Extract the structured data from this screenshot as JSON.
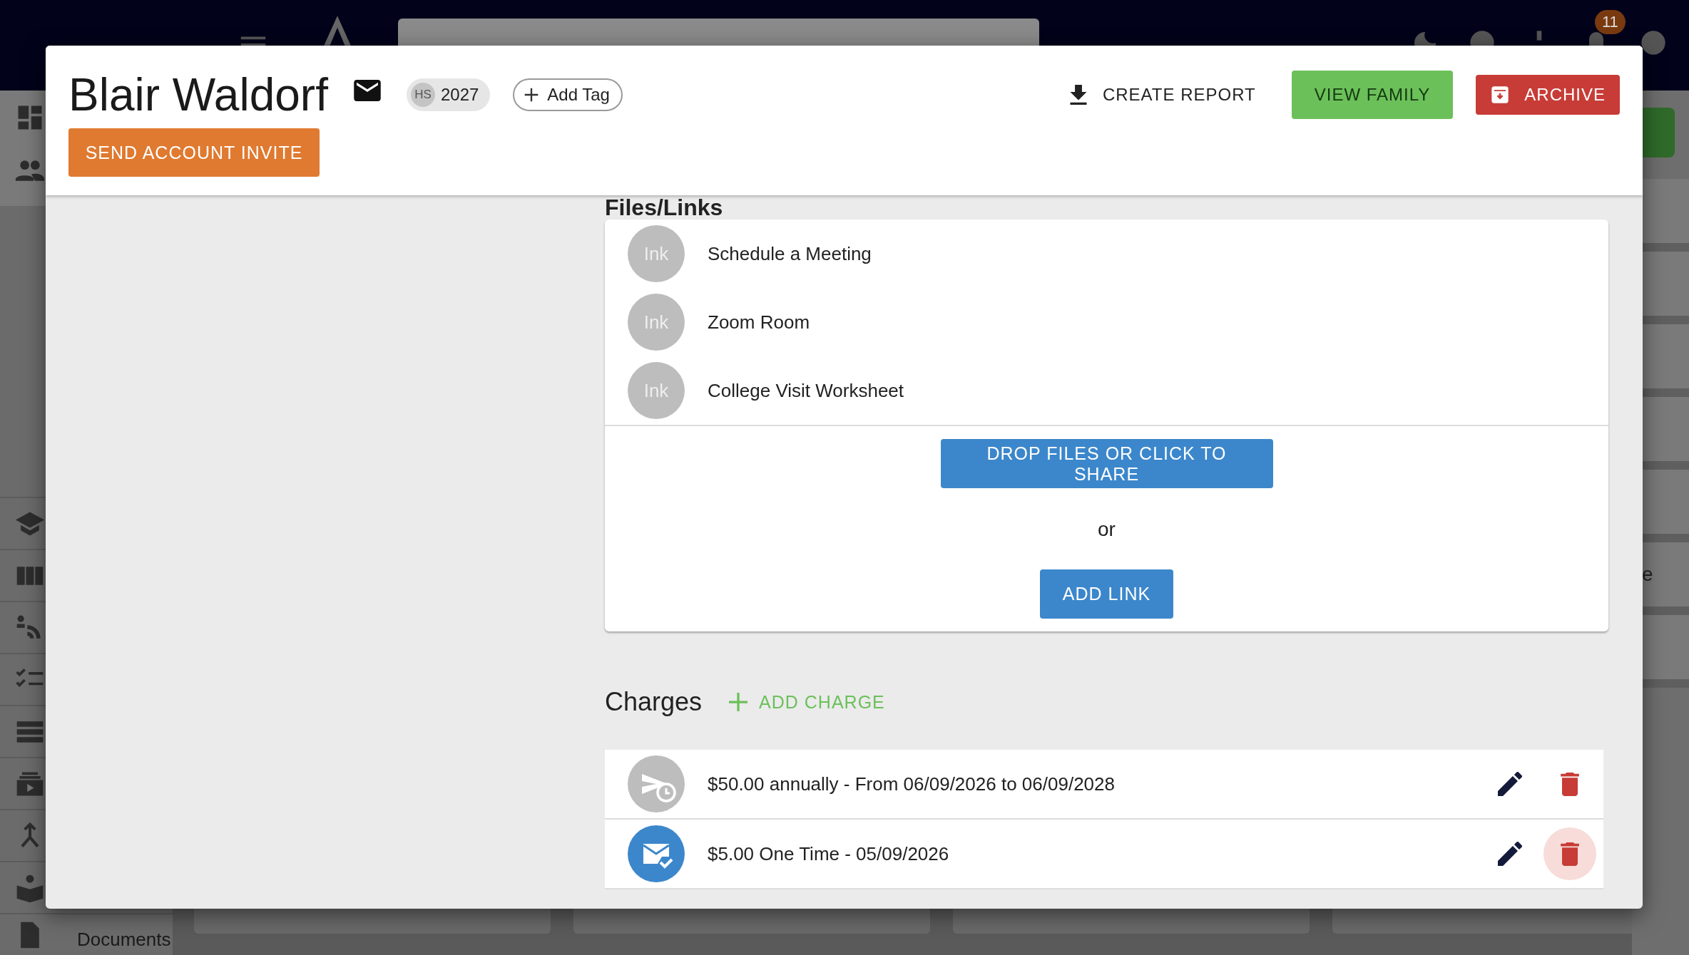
{
  "navbar": {
    "notification_count": "11"
  },
  "sidebar": {
    "visible_label": "Documents"
  },
  "background_fragment": "e",
  "profile": {
    "name": "Blair Waldorf",
    "chip": {
      "prefix": "HS",
      "label": "2027"
    },
    "add_tag": "Add Tag",
    "invite_button": "SEND ACCOUNT INVITE",
    "actions": [
      {
        "label": "CREATE REPORT",
        "kind": "download"
      },
      {
        "label": "VIEW FAMILY",
        "kind": "primary"
      },
      {
        "label": "ARCHIVE",
        "kind": "danger"
      }
    ]
  },
  "files_links": {
    "heading": "Files/Links",
    "items": [
      {
        "avatar": "Ink",
        "name": "Schedule a Meeting"
      },
      {
        "avatar": "Ink",
        "name": "Zoom Room"
      },
      {
        "avatar": "Ink",
        "name": "College Visit Worksheet"
      }
    ],
    "share_button": "DROP FILES OR CLICK TO SHARE",
    "separator": "or",
    "add_link_button": "ADD LINK"
  },
  "charges": {
    "heading": "Charges",
    "add_button": "ADD CHARGE",
    "items": [
      {
        "kind": "scheduled",
        "text": "$50.00 annually - From 06/09/2026 to 06/09/2028",
        "delete_hovered": false
      },
      {
        "kind": "sent",
        "text": "$5.00 One Time - 05/09/2026",
        "delete_hovered": true
      }
    ]
  }
}
